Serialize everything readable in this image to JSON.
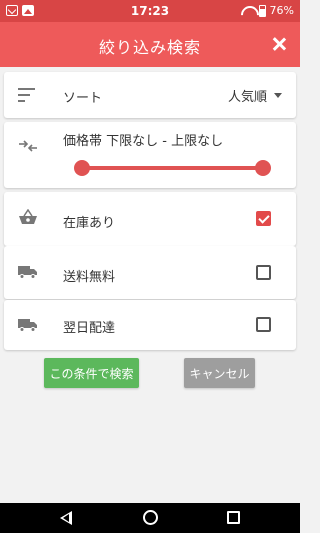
{
  "status_bar": {
    "time": "17:23",
    "battery": "76%"
  },
  "header": {
    "title": "絞り込み検索"
  },
  "sort": {
    "label": "ソート",
    "value": "人気順"
  },
  "price": {
    "label": "価格帯 下限なし - 上限なし"
  },
  "filters": [
    {
      "label": "在庫あり",
      "checked": true
    },
    {
      "label": "送料無料",
      "checked": false
    },
    {
      "label": "翌日配達",
      "checked": false
    }
  ],
  "buttons": {
    "search": "この条件で検索",
    "cancel": "キャンセル"
  },
  "colors": {
    "accent": "#ee5a5a",
    "status_bar": "#d84545",
    "search_button": "#5cb85c",
    "cancel_button": "#9e9e9e"
  }
}
